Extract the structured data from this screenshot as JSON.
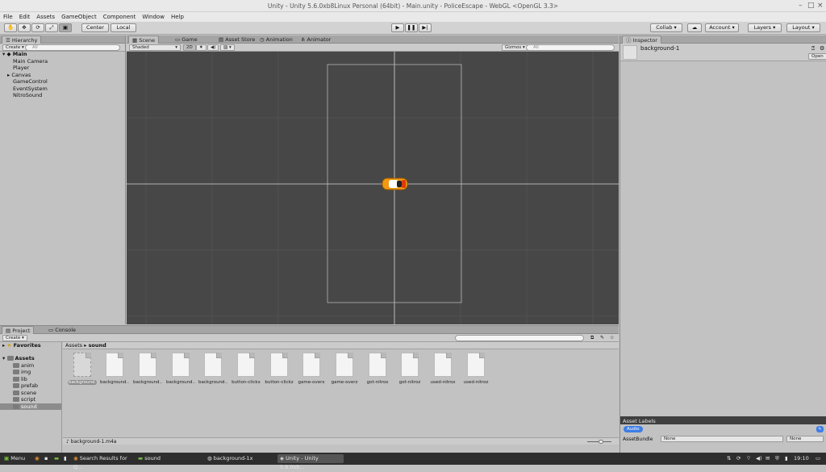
{
  "window": {
    "title": "Unity - Unity 5.6.0xb8Linux Personal (64bit) - Main.unity - PoliceEscape - WebGL <OpenGL 3.3>"
  },
  "menu": [
    "File",
    "Edit",
    "Assets",
    "GameObject",
    "Component",
    "Window",
    "Help"
  ],
  "toolbar": {
    "pivot_label": "Center",
    "space_label": "Local",
    "collab_label": "Collab",
    "account_label": "Account",
    "layers_label": "Layers",
    "layout_label": "Layout"
  },
  "hierarchy": {
    "tab": "Hierarchy",
    "create_label": "Create",
    "search_placeholder": "All",
    "scene_name": "Main",
    "items": [
      "Main Camera",
      "Player",
      "Canvas",
      "GameControl",
      "EventSystem",
      "NitroSound"
    ]
  },
  "scene": {
    "tabs": [
      "Scene",
      "Game",
      "Asset Store",
      "Animation",
      "Animator"
    ],
    "shading": "Shaded",
    "mode_2d": "2D",
    "gizmos_label": "Gizmos",
    "search_placeholder": "All"
  },
  "inspector": {
    "tab": "Inspector",
    "object_name": "background-1",
    "open_label": "Open",
    "labels_title": "Asset Labels",
    "audio_tag": "Audio",
    "bundle_label": "AssetBundle",
    "bundle_value1": "None",
    "bundle_value2": "None"
  },
  "project": {
    "tabs": [
      "Project",
      "Console"
    ],
    "create_label": "Create",
    "favorites": "Favorites",
    "assets_root": "Assets",
    "folders": [
      "anim",
      "img",
      "lib",
      "prefab",
      "scene",
      "script",
      "sound"
    ],
    "breadcrumb": [
      "Assets",
      "sound"
    ],
    "assets": [
      "background...",
      "background...",
      "background...",
      "background...",
      "background...",
      "button-clickx",
      "button-clickz",
      "game-overx",
      "game-overz",
      "got-nitrox",
      "got-nitroz",
      "used-nitrox",
      "used-nitroz"
    ],
    "selected_file": "background-1.m4a"
  },
  "taskbar": {
    "menu_label": "Menu",
    "tasks": [
      "Search Results for Q...",
      "sound",
      "background-1x",
      "Unity - Unity 5.6.0xb..."
    ],
    "clock": "19:10"
  },
  "colors": {
    "scene_bg": "#474747",
    "selection_blue": "#3e7de6",
    "taskbar": "#2e2e2e"
  }
}
